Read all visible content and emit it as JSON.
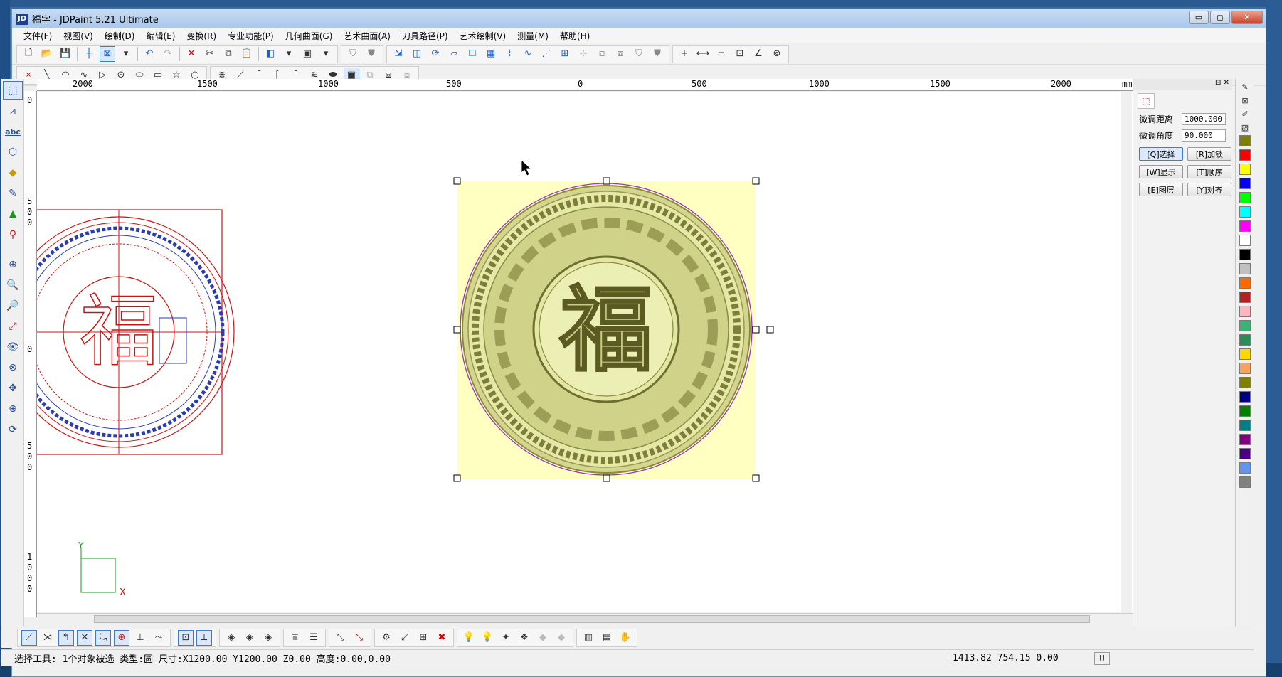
{
  "window": {
    "title": "福字 - JDPaint 5.21 Ultimate",
    "app_icon": "JD",
    "buttons": {
      "minimize": "▭",
      "maximize": "◻",
      "close": "✕"
    }
  },
  "menu": [
    "文件(F)",
    "视图(V)",
    "绘制(D)",
    "编辑(E)",
    "变换(R)",
    "专业功能(P)",
    "几何曲面(G)",
    "艺术曲面(A)",
    "刀具路径(P)",
    "艺术绘制(V)",
    "测量(M)",
    "帮助(H)"
  ],
  "ruler_top": {
    "labels": [
      "2000",
      "1500",
      "1000",
      "500",
      "0",
      "500",
      "1000",
      "1500",
      "2000",
      "mm"
    ]
  },
  "ruler_left": {
    "labels": [
      "0",
      "5\n0\n0",
      "0",
      "5\n0\n0",
      "1\n0\n0\n0"
    ]
  },
  "right_panel": {
    "fine_distance_label": "微调距离",
    "fine_distance_value": "1000.000",
    "fine_angle_label": "微调角度",
    "fine_angle_value": "90.000",
    "buttons": [
      "[Q]选择",
      "[R]加锁",
      "[W]显示",
      "[T]顺序",
      "[E]图层",
      "[Y]对齐"
    ]
  },
  "palette_colors": [
    "#7f7f00",
    "#ff0000",
    "#ffff00",
    "#0000ff",
    "#00ff00",
    "#00ffff",
    "#ff00ff",
    "#ffffff",
    "#000000",
    "#c0c0c0",
    "#ff6a00",
    "#b22222",
    "#ffb6c1",
    "#3cb371",
    "#2e8b57",
    "#ffd700",
    "#f4a460",
    "#808000",
    "#000080",
    "#008000",
    "#008080",
    "#800080",
    "#4b0082",
    "#6495ed",
    "#808080"
  ],
  "canvas": {
    "axis_x_label": "X",
    "axis_y_label": "Y",
    "glyph": "福"
  },
  "status": {
    "text": "选择工具: 1个对象被选 类型:圆 尺寸:X1200.00 Y1200.00 Z0.00 高度:0.00,0.00",
    "coords": "1413.82 754.15 0.00",
    "mode": "U"
  }
}
